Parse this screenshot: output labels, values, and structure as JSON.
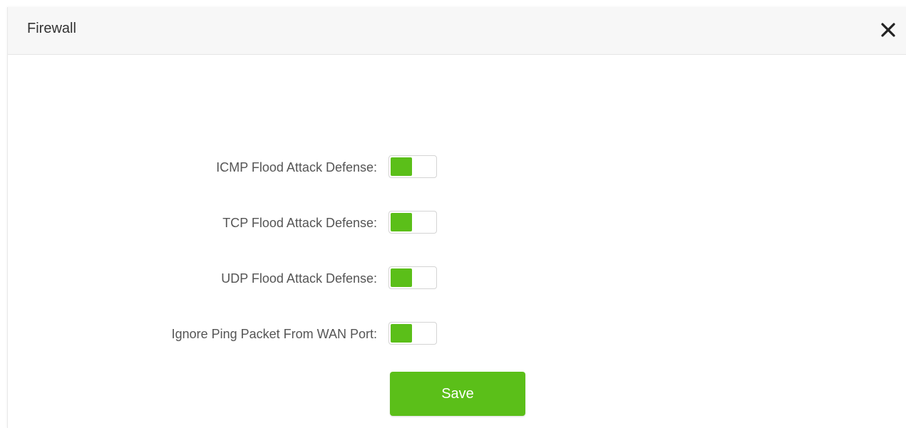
{
  "dialog": {
    "title": "Firewall",
    "close_icon": "close-icon"
  },
  "settings": [
    {
      "label": "ICMP Flood Attack Defense:",
      "enabled": true
    },
    {
      "label": "TCP Flood Attack Defense:",
      "enabled": true
    },
    {
      "label": "UDP Flood Attack Defense:",
      "enabled": true
    },
    {
      "label": "Ignore Ping Packet From WAN Port:",
      "enabled": true
    }
  ],
  "actions": {
    "save_label": "Save"
  },
  "colors": {
    "accent": "#5bbf19",
    "header_bg": "#f7f7f7",
    "label_text": "#555555"
  }
}
